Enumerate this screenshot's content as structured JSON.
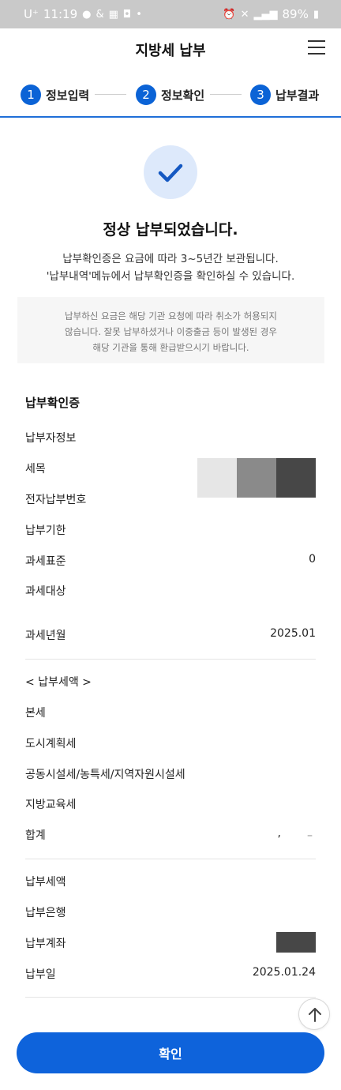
{
  "status_bar": {
    "carrier": "U⁺",
    "time": "11:19",
    "battery": "89%"
  },
  "header": {
    "title": "지방세 납부"
  },
  "steps": [
    {
      "number": "1",
      "label": "정보입력"
    },
    {
      "number": "2",
      "label": "정보확인"
    },
    {
      "number": "3",
      "label": "납부결과"
    }
  ],
  "result": {
    "title": "정상 납부되었습니다.",
    "desc_line1": "납부확인증은 요금에 따라 3~5년간 보관됩니다.",
    "desc_line2": "'납부내역'메뉴에서 납부확인증을 확인하실 수 있습니다."
  },
  "notice": {
    "line1": "납부하신 요금은 해당 기관 요청에 따라 취소가 허용되지",
    "line2": "않습니다. 잘못 납부하셨거나 이중출금 등이 발생된 경우",
    "line3": "해당 기관을 통해 환급받으시기 바랍니다."
  },
  "receipt": {
    "section_title": "납부확인증",
    "rows": [
      {
        "key": "납부자정보",
        "value": ""
      },
      {
        "key": "세목",
        "value": ""
      },
      {
        "key": "전자납부번호",
        "value": ""
      },
      {
        "key": "납부기한",
        "value": ""
      },
      {
        "key": "과세표준",
        "value": "0"
      },
      {
        "key": "과세대상",
        "value": ""
      },
      {
        "key": "과세년월",
        "value": "2025.01"
      }
    ],
    "tax_header": "< 납부세액 >",
    "tax_rows": [
      {
        "key": "본세",
        "value": ""
      },
      {
        "key": "도시계획세",
        "value": ""
      },
      {
        "key": "공동시설세/농특세/지역자원시설세",
        "value": ""
      },
      {
        "key": "지방교육세",
        "value": ""
      },
      {
        "key": "합계",
        "value": ","
      }
    ],
    "pay_rows": [
      {
        "key": "납부세액",
        "value": ""
      },
      {
        "key": "납부은행",
        "value": ""
      },
      {
        "key": "납부계좌",
        "value": ""
      },
      {
        "key": "납부일",
        "value": "2025.01.24"
      }
    ]
  },
  "confirm_button": "확인",
  "colors": {
    "accent": "#0e63db",
    "step_circle": "#0b63d6",
    "success_bg": "#dde9fb"
  },
  "icons": {
    "success": "check-icon",
    "menu": "hamburger-icon",
    "scroll_top": "arrow-up-icon"
  }
}
